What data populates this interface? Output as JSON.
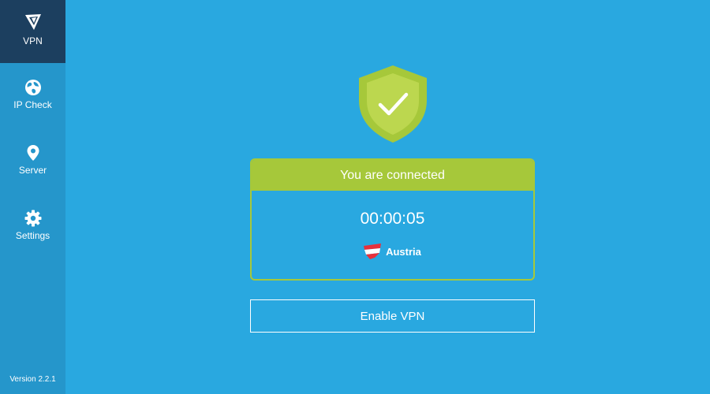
{
  "colors": {
    "background": "#29a8e0",
    "sidebar": "#2596cb",
    "sidebar_active": "#1c3f5f",
    "accent_green": "#a6c83a",
    "shield_inner": "#bcd74f",
    "text": "#ffffff"
  },
  "sidebar": {
    "items": [
      {
        "label": "VPN",
        "icon": "vpn-logo-icon",
        "active": true
      },
      {
        "label": "IP Check",
        "icon": "globe-icon",
        "active": false
      },
      {
        "label": "Server",
        "icon": "location-pin-icon",
        "active": false
      },
      {
        "label": "Settings",
        "icon": "gear-icon",
        "active": false
      }
    ],
    "version": "Version 2.2.1"
  },
  "main": {
    "shield_icon": "shield-check-icon",
    "status": {
      "title": "You are connected",
      "timer": "00:00:05",
      "country": "Austria",
      "flag_icon": "austria-flag-icon"
    },
    "enable_button_label": "Enable VPN"
  }
}
